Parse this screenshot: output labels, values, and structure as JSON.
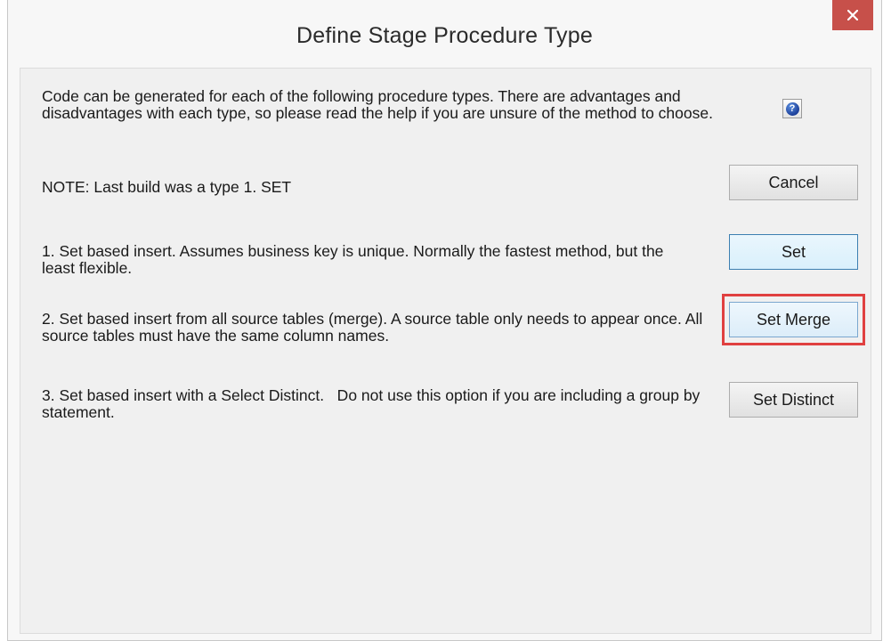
{
  "window": {
    "title": "Define Stage Procedure Type",
    "close_icon": "close-icon"
  },
  "content": {
    "intro": "Code can be generated for each of the following procedure types. There are advantages and disadvantages with each type, so please read the help if you are unsure of the method to choose.",
    "note": "NOTE: Last build was a type 1. SET",
    "option1": "1. Set based insert. Assumes business key is unique. Normally the fastest method, but the least flexible.",
    "option2": "2. Set based insert from all source tables (merge). A source table only needs to appear once. All source tables must have the same column names.",
    "option3": "3. Set based insert with a Select Distinct.   Do not use this option if you are including a group by statement."
  },
  "buttons": {
    "help_icon": "help-icon",
    "help_glyph": "?",
    "cancel": "Cancel",
    "set": "Set",
    "set_merge": "Set Merge",
    "set_distinct": "Set Distinct"
  },
  "colors": {
    "close_button": "#c7504a",
    "highlight_box": "#e04040",
    "default_button_border": "#3c7fb1"
  }
}
